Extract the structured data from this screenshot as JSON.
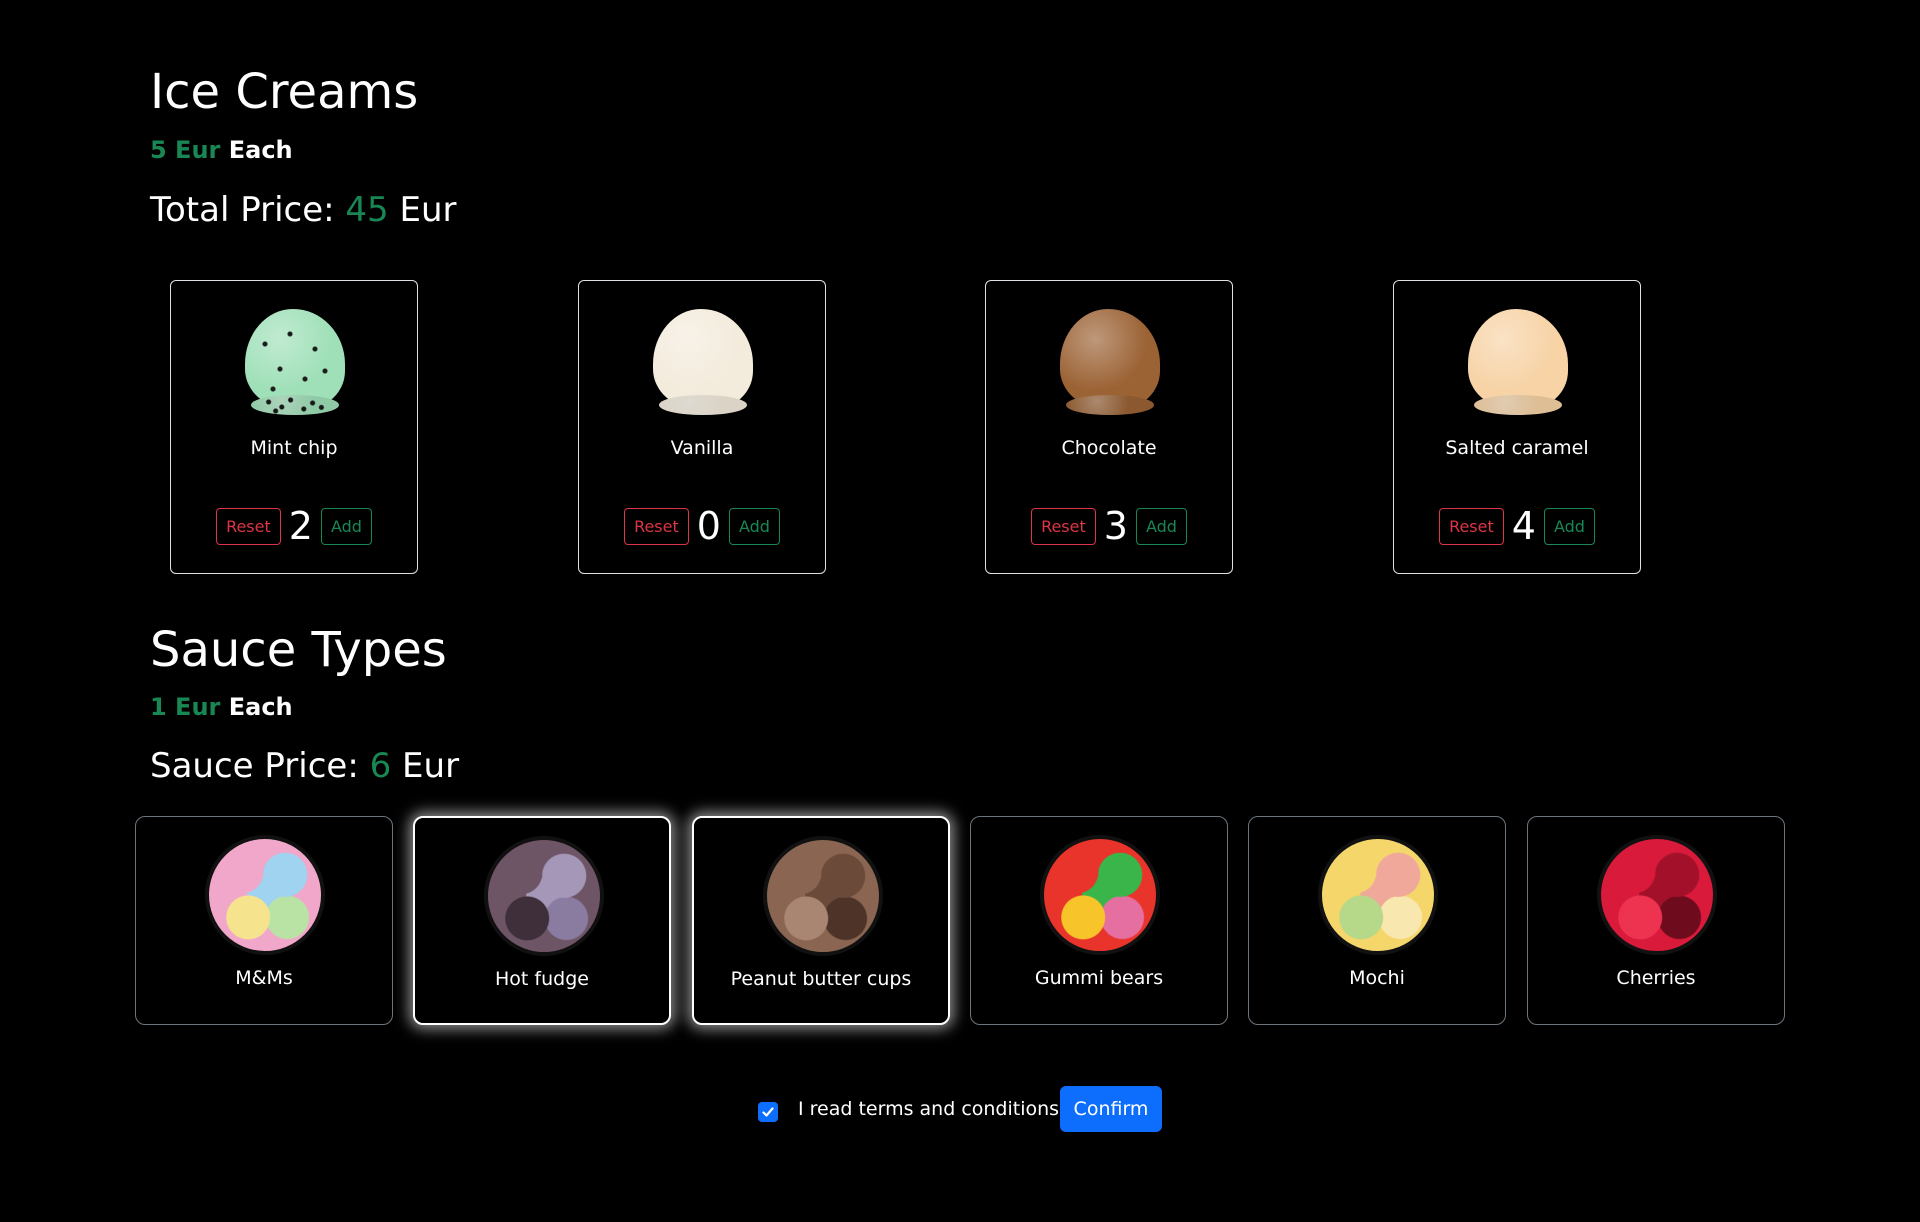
{
  "ice_creams": {
    "title": "Ice Creams",
    "unit_price": "5 Eur",
    "unit_suffix": "Each",
    "total_label": "Total Price:",
    "total_value": "45",
    "total_currency": "Eur",
    "items": [
      {
        "name": "Mint chip",
        "qty": "2",
        "color": "#9fe0b8"
      },
      {
        "name": "Vanilla",
        "qty": "0",
        "color": "#f3ebdc"
      },
      {
        "name": "Chocolate",
        "qty": "3",
        "color": "#9b6234"
      },
      {
        "name": "Salted caramel",
        "qty": "4",
        "color": "#f7d3a6"
      }
    ],
    "reset_label": "Reset",
    "add_label": "Add"
  },
  "sauces": {
    "title": "Sauce Types",
    "unit_price": "1 Eur",
    "unit_suffix": "Each",
    "total_label": "Sauce Price:",
    "total_value": "6",
    "total_currency": "Eur",
    "items": [
      {
        "name": "M&Ms",
        "selected": false,
        "colors": [
          "#f1a7c9",
          "#9fd3f0",
          "#f6e38d",
          "#b9e3a5"
        ]
      },
      {
        "name": "Hot fudge",
        "selected": true,
        "colors": [
          "#6e5566",
          "#a597b8",
          "#3f2f3b",
          "#8a7ba0"
        ]
      },
      {
        "name": "Peanut butter cups",
        "selected": true,
        "colors": [
          "#8a6551",
          "#6b4a3a",
          "#a88672",
          "#4e3428"
        ]
      },
      {
        "name": "Gummi bears",
        "selected": false,
        "colors": [
          "#e8342a",
          "#39b54a",
          "#f7c52a",
          "#e46fa0"
        ]
      },
      {
        "name": "Mochi",
        "selected": false,
        "colors": [
          "#f4d66b",
          "#f0a89a",
          "#b5d889",
          "#f9e7b0"
        ]
      },
      {
        "name": "Cherries",
        "selected": false,
        "colors": [
          "#d91a3a",
          "#a3102a",
          "#ee3350",
          "#6e0b1c"
        ]
      }
    ]
  },
  "footer": {
    "terms_label": "I read terms and conditions",
    "terms_checked": true,
    "confirm_label": "Confirm"
  }
}
